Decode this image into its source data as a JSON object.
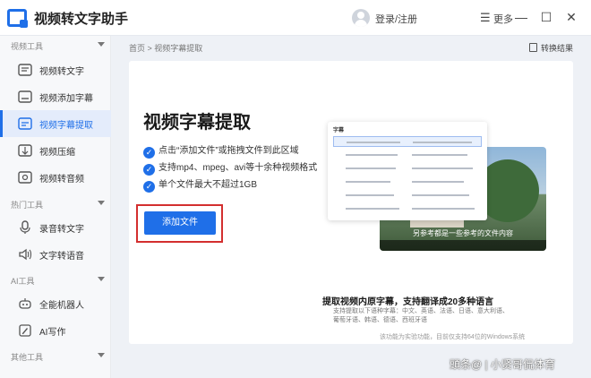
{
  "app": {
    "title": "视频转文字助手"
  },
  "header": {
    "login_label": "登录/注册",
    "menu_icon": "☰",
    "more_label": "更多",
    "window_controls": {
      "minimize": "—",
      "maximize": "☐",
      "close": "✕"
    }
  },
  "sidebar": {
    "sections": [
      {
        "label": "视频工具",
        "items": [
          {
            "label": "视频转文字",
            "icon": "video-to-text-icon"
          },
          {
            "label": "视频添加字幕",
            "icon": "video-subtitle-icon"
          },
          {
            "label": "视频字幕提取",
            "icon": "subtitle-extract-icon",
            "active": true
          },
          {
            "label": "视频压缩",
            "icon": "video-compress-icon"
          },
          {
            "label": "视频转音频",
            "icon": "video-to-audio-icon"
          }
        ]
      },
      {
        "label": "热门工具",
        "items": [
          {
            "label": "录音转文字",
            "icon": "recording-to-text-icon"
          },
          {
            "label": "文字转语音",
            "icon": "text-to-speech-icon"
          }
        ]
      },
      {
        "label": "AI工具",
        "items": [
          {
            "label": "全能机器人",
            "icon": "robot-icon"
          },
          {
            "label": "AI写作",
            "icon": "ai-writing-icon"
          }
        ]
      },
      {
        "label": "其他工具",
        "items": []
      }
    ]
  },
  "main": {
    "breadcrumb": "首页 > 视频字幕提取",
    "convert_result_label": "转换结果",
    "title": "视频字幕提取",
    "features": [
      "点击“添加文件”或拖拽文件到此区域",
      "支持mp4、mpeg、avi等十余种视频格式",
      "单个文件最大不超过1GB"
    ],
    "add_button_label": "添加文件",
    "preview": {
      "card_title": "字幕",
      "video_subtitle": "另参考都是一些参考的文件内容"
    },
    "caption": "提取视频内原字幕，支持翻译成20多种语言",
    "caption_sub": "支持提取以下语种字幕：中文、英语、法语、日语、意大利语、葡萄牙语、韩语、德语、西班牙语",
    "footnote": "该功能为实验功能，目前仅支持64位的Windows系统"
  },
  "watermark": "頭条@ | 小贤哥侃体育",
  "colors": {
    "accent": "#1f6fe8",
    "highlight_border": "#d32f2f",
    "sidebar_bg": "#f7f8fa",
    "main_bg": "#eef1f6"
  }
}
